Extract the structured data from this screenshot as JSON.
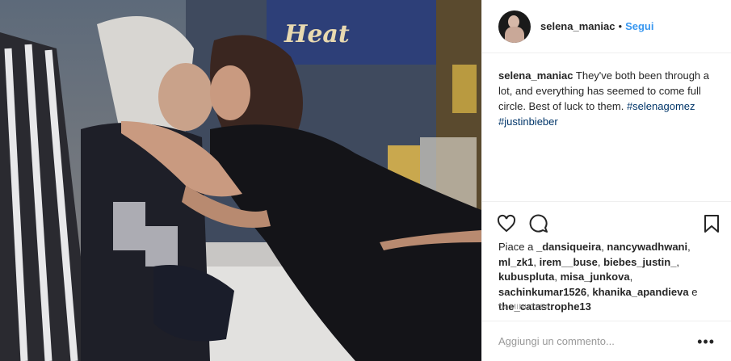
{
  "post": {
    "username": "selena_maniac",
    "separator": "•",
    "follow_label": "Segui",
    "caption_user": "selena_maniac",
    "caption_text": " They've both been through a lot, and everything has seemed to come full circle. Best of luck to them. ",
    "hashtags": [
      "#selenagomez",
      "#justinbieber"
    ],
    "likes_prefix": "Piace a ",
    "likers": [
      "_dansiqueira",
      "nancywadhwani",
      "ml_zk1",
      "irem__buse",
      "biebes_justin_",
      "kubuspluta",
      "misa_junkova",
      "sachinkumar1526",
      "khanika_apandieva"
    ],
    "likes_and": " e ",
    "last_liker": "the_catastrophe13",
    "timestamp": "14 MINUTI FA",
    "comment_placeholder": "Aggiungi un commento...",
    "more_label": "•••"
  },
  "photo": {
    "sign_text": "Heat"
  }
}
